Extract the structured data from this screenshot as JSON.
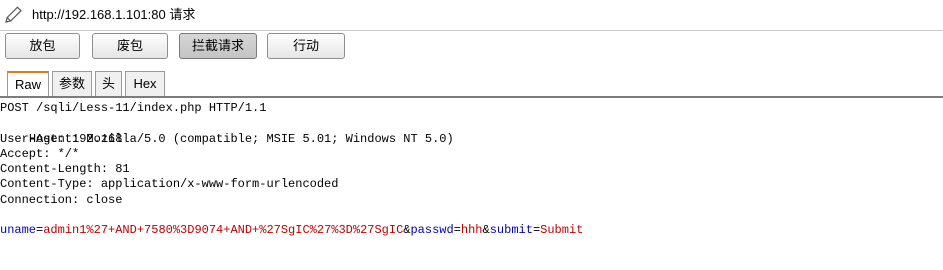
{
  "title": {
    "text": "http://192.168.1.101:80 请求"
  },
  "toolbar": {
    "buttons": [
      {
        "label": "放包"
      },
      {
        "label": "废包"
      },
      {
        "label": "拦截请求"
      },
      {
        "label": "行动"
      }
    ]
  },
  "tabs": [
    {
      "label": "Raw"
    },
    {
      "label": "参数"
    },
    {
      "label": "头"
    },
    {
      "label": "Hex"
    }
  ],
  "request": {
    "lines": [
      "POST /sqli/Less-11/index.php HTTP/1.1",
      "Host: 192.168",
      "User-Agent: Mozilla/5.0 (compatible; MSIE 5.01; Windows NT 5.0)",
      "Accept: */*",
      "Content-Length: 81",
      "Content-Type: application/x-www-form-urlencoded",
      "Connection: close"
    ],
    "body_params": [
      {
        "name": "uname",
        "value": "admin1%27+AND+7580%3D9074+AND+%27SgIC%27%3D%27SgIC"
      },
      {
        "name": "passwd",
        "value": "hhh"
      },
      {
        "name": "submit",
        "value": "Submit"
      }
    ]
  },
  "colors": {
    "param_name": "#0000c0",
    "param_value": "#c00000",
    "active_tab_accent": "#e07b1a"
  }
}
